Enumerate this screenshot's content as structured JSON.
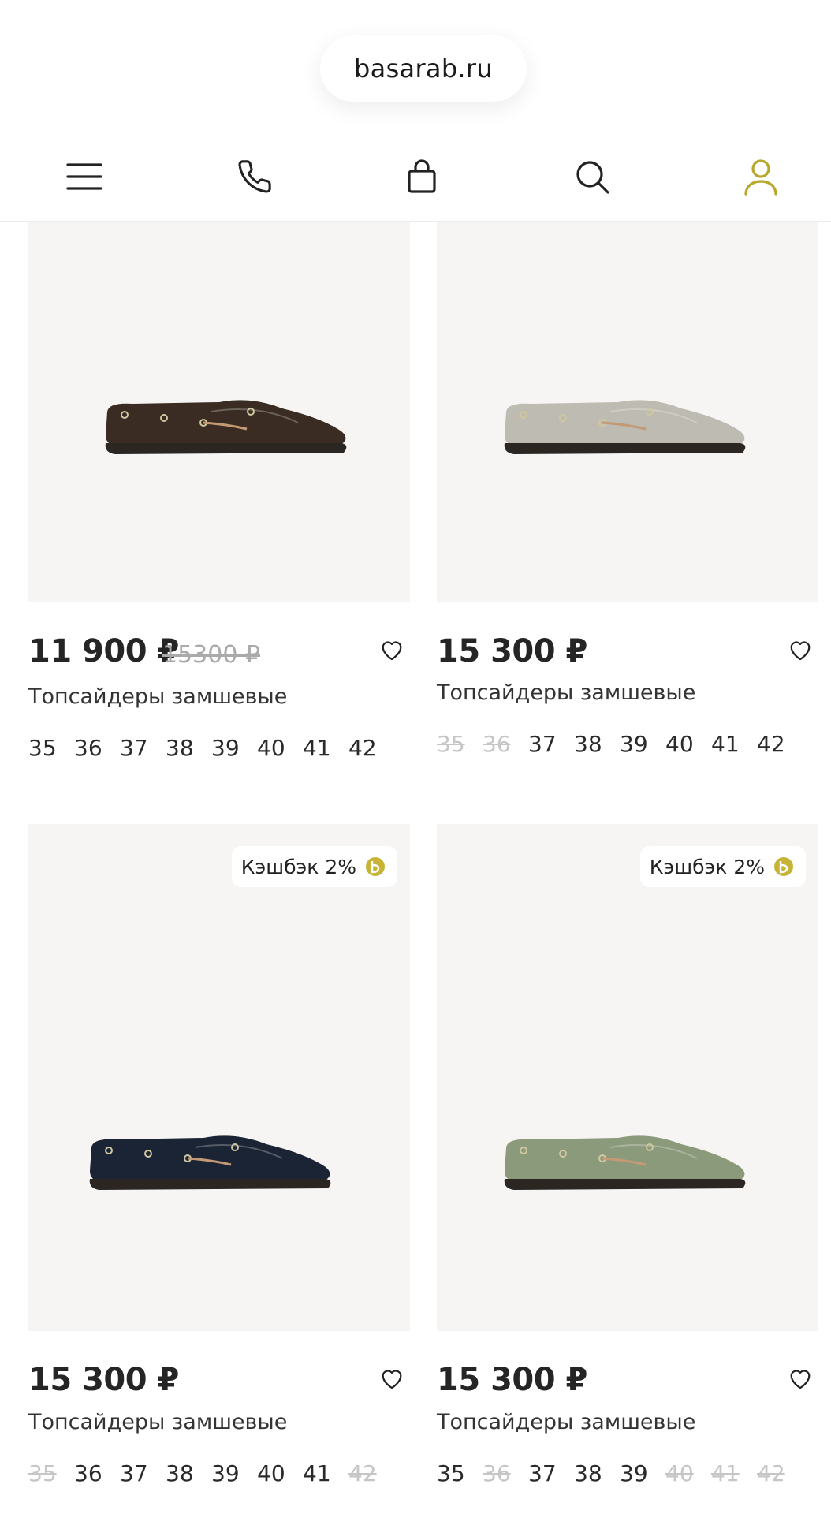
{
  "url": "basarab.ru",
  "nav": {
    "icons": [
      "menu-icon",
      "phone-icon",
      "bag-icon",
      "search-icon",
      "user-icon"
    ],
    "accent_color": "#b7a72b"
  },
  "products": [
    {
      "price": "11 900 ₽",
      "old_price": "15300 ₽",
      "title": "Топсайдеры замшевые",
      "badge": "",
      "shoe_color": "#3a2c22",
      "sizes": [
        {
          "label": "35",
          "available": true
        },
        {
          "label": "36",
          "available": true
        },
        {
          "label": "37",
          "available": true
        },
        {
          "label": "38",
          "available": true
        },
        {
          "label": "39",
          "available": true
        },
        {
          "label": "40",
          "available": true
        },
        {
          "label": "41",
          "available": true
        },
        {
          "label": "42",
          "available": true
        }
      ]
    },
    {
      "price": "15 300 ₽",
      "old_price": "",
      "title": "Топсайдеры замшевые",
      "badge": "",
      "shoe_color": "#bdbbb2",
      "sizes": [
        {
          "label": "35",
          "available": false
        },
        {
          "label": "36",
          "available": false
        },
        {
          "label": "37",
          "available": true
        },
        {
          "label": "38",
          "available": true
        },
        {
          "label": "39",
          "available": true
        },
        {
          "label": "40",
          "available": true
        },
        {
          "label": "41",
          "available": true
        },
        {
          "label": "42",
          "available": true
        }
      ]
    },
    {
      "price": "15 300 ₽",
      "old_price": "",
      "title": "Топсайдеры замшевые",
      "badge": "Кэшбэк 2%",
      "shoe_color": "#1b2434",
      "sizes": [
        {
          "label": "35",
          "available": false
        },
        {
          "label": "36",
          "available": true
        },
        {
          "label": "37",
          "available": true
        },
        {
          "label": "38",
          "available": true
        },
        {
          "label": "39",
          "available": true
        },
        {
          "label": "40",
          "available": true
        },
        {
          "label": "41",
          "available": true
        },
        {
          "label": "42",
          "available": false
        }
      ]
    },
    {
      "price": "15 300 ₽",
      "old_price": "",
      "title": "Топсайдеры замшевые",
      "badge": "Кэшбэк 2%",
      "shoe_color": "#8c9a7c",
      "sizes": [
        {
          "label": "35",
          "available": true
        },
        {
          "label": "36",
          "available": false
        },
        {
          "label": "37",
          "available": true
        },
        {
          "label": "38",
          "available": true
        },
        {
          "label": "39",
          "available": true
        },
        {
          "label": "40",
          "available": false
        },
        {
          "label": "41",
          "available": false
        },
        {
          "label": "42",
          "available": false
        }
      ]
    }
  ]
}
